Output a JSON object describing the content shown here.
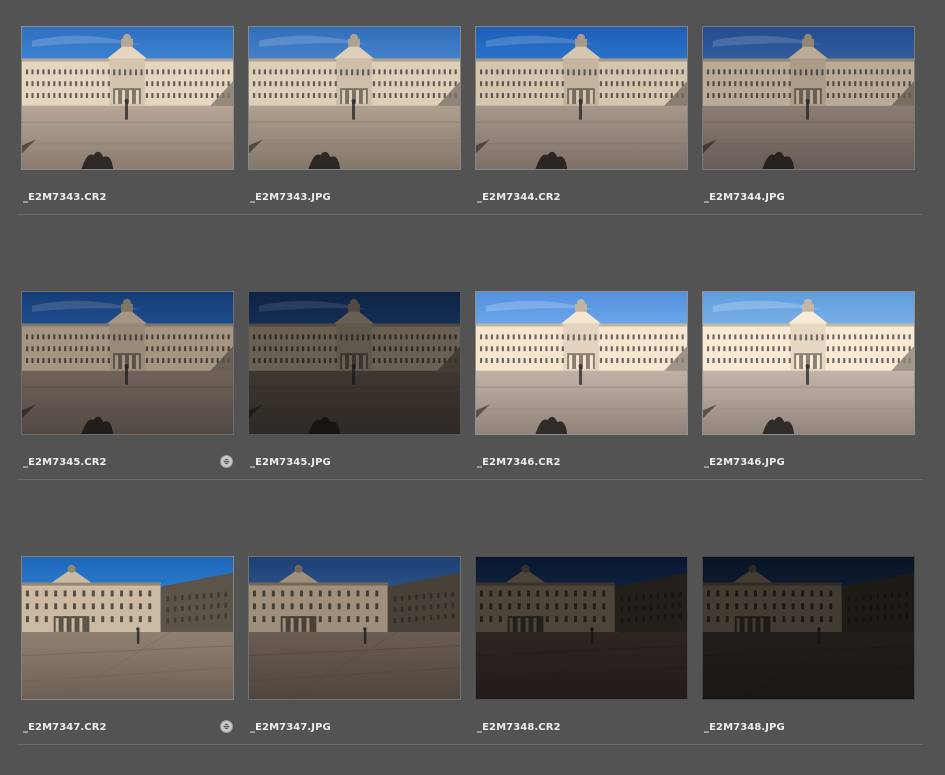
{
  "grid": {
    "rows": [
      {
        "items": [
          {
            "filename": "_E2M7343.CR2",
            "scene": "front",
            "sky": "#3f86d6",
            "sky_top": "#2f6fbf",
            "facade": "#e7d6bf",
            "ground": "#a79689",
            "shade": 1.0,
            "badge": false
          },
          {
            "filename": "_E2M7343.JPG",
            "scene": "front",
            "sky": "#4a8ad4",
            "sky_top": "#336fbd",
            "facade": "#e4d3bd",
            "ground": "#a49384",
            "shade": 0.98,
            "badge": false
          },
          {
            "filename": "_E2M7344.CR2",
            "scene": "front",
            "sky": "#2e7ed8",
            "sky_top": "#1e61bf",
            "facade": "#dfcdb6",
            "ground": "#9e8f84",
            "shade": 0.96,
            "badge": false
          },
          {
            "filename": "_E2M7344.JPG",
            "scene": "front",
            "sky": "#3a6fb8",
            "sky_top": "#2a56a0",
            "facade": "#d3c1aa",
            "ground": "#8f8178",
            "shade": 0.88,
            "badge": false
          }
        ]
      },
      {
        "items": [
          {
            "filename": "_E2M7345.CR2",
            "scene": "front",
            "sky": "#2b64b5",
            "sky_top": "#1b4c97",
            "facade": "#cdbba3",
            "ground": "#7e6f66",
            "shade": 0.8,
            "badge": true,
            "badge_icon": "stack-badge-icon"
          },
          {
            "filename": "_E2M7345.JPG",
            "scene": "front",
            "sky": "#234e8c",
            "sky_top": "#163a70",
            "facade": "#a99a86",
            "ground": "#5b5149",
            "shade": 0.62,
            "badge": false
          },
          {
            "filename": "_E2M7346.CR2",
            "scene": "front",
            "sky": "#6aa2df",
            "sky_top": "#4f8bd4",
            "facade": "#ecdcc6",
            "ground": "#a8998f",
            "shade": 1.05,
            "badge": false
          },
          {
            "filename": "_E2M7346.JPG",
            "scene": "front",
            "sky": "#7aacde",
            "sky_top": "#5a95d2",
            "facade": "#efe0cb",
            "ground": "#a99b91",
            "shade": 1.05,
            "badge": false
          }
        ]
      },
      {
        "items": [
          {
            "filename": "_E2M7347.CR2",
            "scene": "angle",
            "sky": "#2f86d8",
            "sky_top": "#1f6cc4",
            "facade": "#d8c4aa",
            "ground": "#8e7d6f",
            "shade": 0.95,
            "badge": true,
            "badge_icon": "stack-badge-icon"
          },
          {
            "filename": "_E2M7347.JPG",
            "scene": "angle",
            "sky": "#3566a8",
            "sky_top": "#254f8d",
            "facade": "#c3af96",
            "ground": "#78695d",
            "shade": 0.82,
            "badge": false
          },
          {
            "filename": "_E2M7348.CR2",
            "scene": "angle",
            "sky": "#1c3f72",
            "sky_top": "#112c55",
            "facade": "#8e7d6a",
            "ground": "#4d3d38",
            "shade": 0.55,
            "badge": false
          },
          {
            "filename": "_E2M7348.JPG",
            "scene": "angle",
            "sky": "#1f3a63",
            "sky_top": "#13284a",
            "facade": "#857563",
            "ground": "#413833",
            "shade": 0.5,
            "badge": false
          }
        ]
      }
    ]
  }
}
